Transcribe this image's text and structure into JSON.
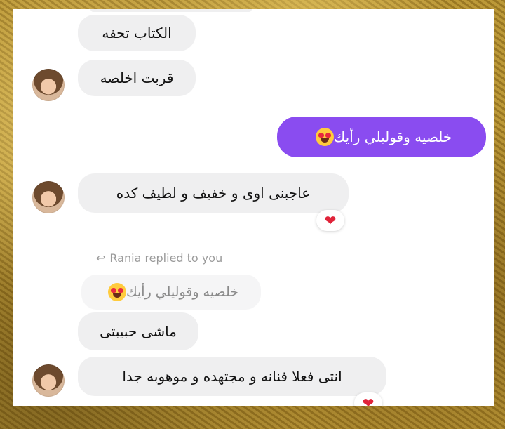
{
  "messages": [
    {
      "id": "m1",
      "text": "الكتاب تحفه",
      "side": "in"
    },
    {
      "id": "m2",
      "text": "قربت اخلصه",
      "side": "in"
    },
    {
      "id": "m3",
      "text": "خلصيه وقوليلي رأيك",
      "side": "out",
      "emoji": "heart-eyes-emoji"
    },
    {
      "id": "m4",
      "text": "عاجبنى اوى و خفيف و لطيف كده",
      "side": "in",
      "reaction": "❤"
    },
    {
      "id": "m5",
      "text": "ماشى حبيبتى",
      "side": "in"
    },
    {
      "id": "m6",
      "text": "انتى فعلا فنانه و مجتهده و موهوبه جدا",
      "side": "in",
      "reaction": "❤"
    }
  ],
  "reply": {
    "label": "Rania replied to you",
    "quoted_text": "خلصيه وقوليلي رأيك",
    "quoted_emoji": "heart-eyes-emoji"
  },
  "colors": {
    "outgoing_bubble": "#8a4cf0",
    "incoming_bubble": "#efeff0",
    "reaction_heart": "#e0243a",
    "frame": "#b28d2b"
  },
  "icons": {
    "reply": "reply-arrow-icon",
    "avatar": "avatar",
    "reaction": "red-heart-icon"
  }
}
